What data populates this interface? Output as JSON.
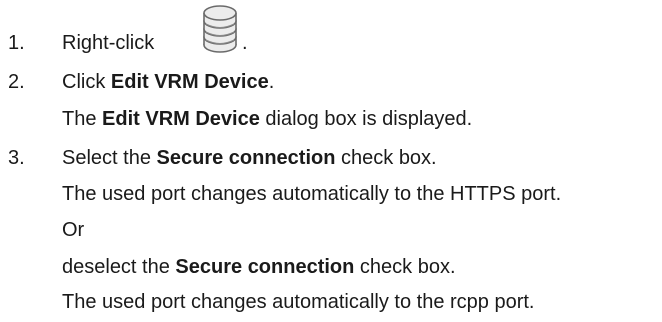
{
  "steps": [
    {
      "number": "1.",
      "text_before_icon": "Right-click",
      "icon": "vrm-device-stack-icon",
      "text_after_icon": "."
    },
    {
      "number": "2.",
      "line1": {
        "pre": "Click ",
        "bold": "Edit VRM Device",
        "post": "."
      },
      "line2": {
        "pre": "The ",
        "bold": "Edit VRM Device",
        "post": " dialog box is displayed."
      }
    },
    {
      "number": "3.",
      "line1": {
        "pre": "Select the ",
        "bold": "Secure connection",
        "post": " check box."
      },
      "line2": "The used port changes automatically to the HTTPS port.",
      "line3": "Or",
      "line4": {
        "pre": "deselect the ",
        "bold": "Secure connection",
        "post": " check box."
      },
      "line5": "The used port changes automatically to the rcpp port."
    }
  ]
}
